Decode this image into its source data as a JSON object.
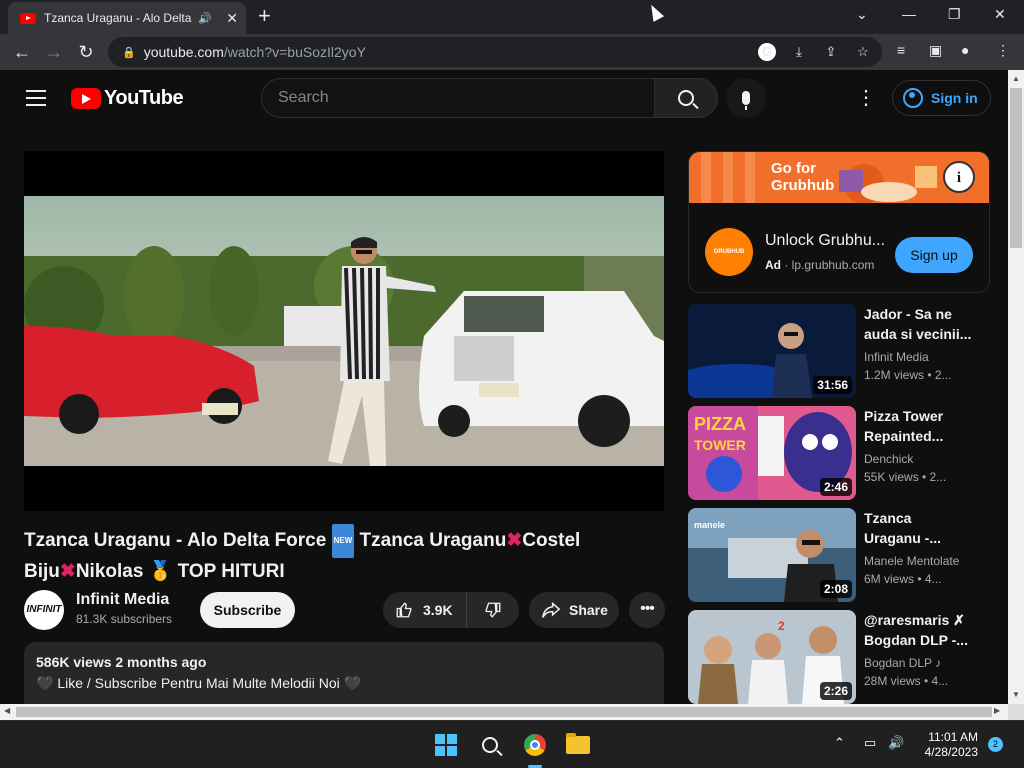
{
  "browser": {
    "tab_title": "Tzanca Uraganu - Alo Delta F",
    "url_domain": "youtube.com",
    "url_path": "/watch?v=buSozIl2yoY"
  },
  "masthead": {
    "logo_text": "YouTube",
    "search_placeholder": "Search",
    "signin_label": "Sign in"
  },
  "video": {
    "title_part1": "Tzanca Uraganu - Alo Delta Force",
    "new_badge": "NEW",
    "title_part2": "Tzanca Uraganu",
    "title_part3": "Costel Biju",
    "title_part4": "Nikolas",
    "title_part5": "TOP HITURI",
    "channel_name": "Infinit Media",
    "channel_avatar_text": "INFINIT",
    "subscribers": "81.3K subscribers",
    "subscribe_label": "Subscribe",
    "likes": "3.9K",
    "share_label": "Share",
    "views_date": "586K views  2 months ago",
    "description_line": "🖤 Like / Subscribe Pentru Mai Multe Melodii Noi 🖤"
  },
  "ad": {
    "banner_text_line1": "Go for",
    "banner_text_line2": "Grubhub",
    "logo_text": "GRUBHUB",
    "title": "Unlock Grubhu...",
    "ad_badge": "Ad",
    "domain": "lp.grubhub.com",
    "cta": "Sign up"
  },
  "recommendations": [
    {
      "title_line1": "Jador - Sa ne",
      "title_line2": "auda si vecinii...",
      "channel": "Infinit Media",
      "meta": "1.2M views  • 2...",
      "duration": "31:56"
    },
    {
      "title_line1": "Pizza Tower",
      "title_line2": "Repainted...",
      "channel": "Denchick",
      "meta": "55K views  • 2...",
      "duration": "2:46"
    },
    {
      "title_line1": "Tzanca",
      "title_line2": "Uraganu -...",
      "channel": "Manele Mentolate",
      "meta": "6M views  • 4...",
      "duration": "2:08"
    },
    {
      "title_line1": "@raresmaris ✗",
      "title_line2": "Bogdan DLP -...",
      "channel": "Bogdan DLP ♪",
      "meta": "28M views  • 4...",
      "duration": "2:26"
    }
  ],
  "taskbar": {
    "time": "11:01 AM",
    "date": "4/28/2023",
    "notifications": "2"
  },
  "colors": {
    "yt_background": "#0f0f0f",
    "yt_red": "#ff0000",
    "link_blue": "#3ea6ff",
    "ad_orange": "#f26f2b"
  }
}
